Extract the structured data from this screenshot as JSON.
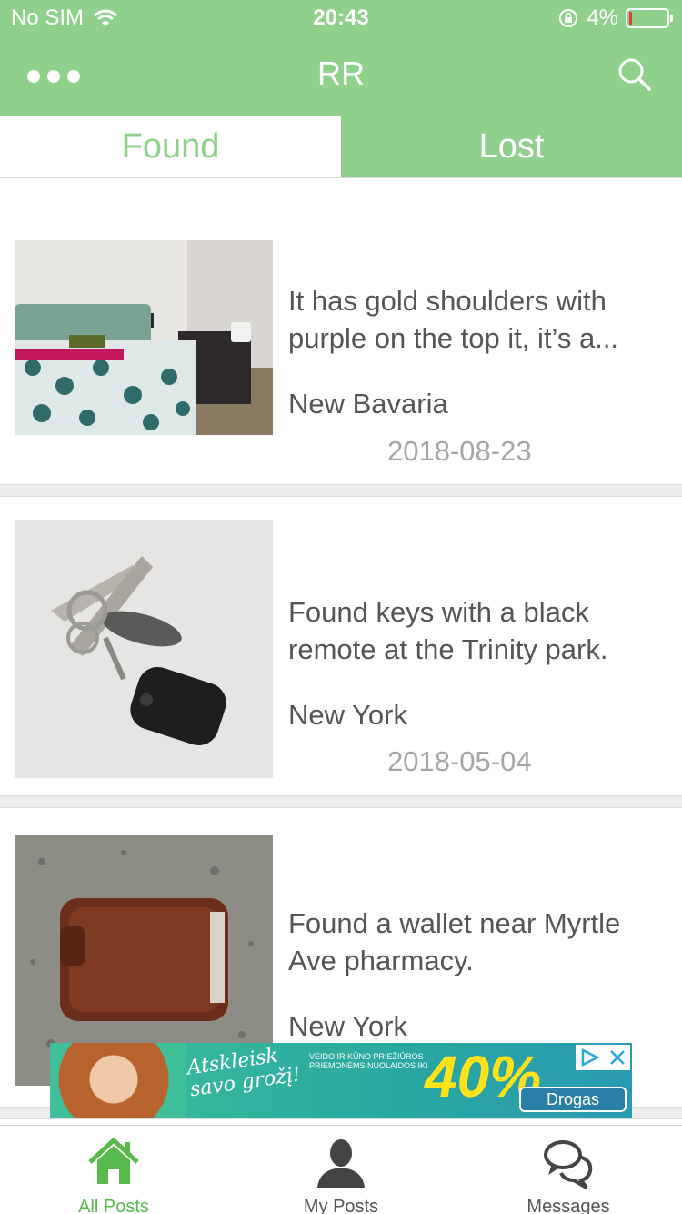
{
  "status_bar": {
    "carrier": "No SIM",
    "time": "20:43",
    "battery": "4%"
  },
  "nav": {
    "title": "RR",
    "more_icon": "more-dots-icon",
    "search_icon": "search-icon"
  },
  "tabs": [
    {
      "label": "Found",
      "active": true
    },
    {
      "label": "Lost",
      "active": false
    }
  ],
  "posts": [
    {
      "description": "It has gold shoulders with purple on the top it, it’s a...",
      "location": "New Bavaria",
      "date": "2018-08-23",
      "image": "bedroom-photo"
    },
    {
      "description": "Found keys with a black remote at the Trinity park.",
      "location": "New York",
      "date": "2018-05-04",
      "image": "keys-photo"
    },
    {
      "description": "Found a wallet near Myrtle Ave pharmacy.",
      "location": "New York",
      "date": "",
      "image": "wallet-photo"
    }
  ],
  "ad": {
    "headline_line1": "Atskleisk",
    "headline_line2": "savo grožį!",
    "small_text": "VEIDO IR KŪNO PRIEŽIŪROS PRIEMONĖMS NUOLAIDOS IKI",
    "percent": "40%",
    "brand": "Drogas"
  },
  "bottom_tabs": [
    {
      "label": "All Posts",
      "icon": "home-icon",
      "active": true
    },
    {
      "label": "My Posts",
      "icon": "person-icon",
      "active": false
    },
    {
      "label": "Messages",
      "icon": "chat-bubbles-icon",
      "active": false
    }
  ],
  "colors": {
    "accent": "#8fd18c",
    "active_tab_label": "#58b94d",
    "text": "#555555",
    "date": "#a6a6a6"
  }
}
